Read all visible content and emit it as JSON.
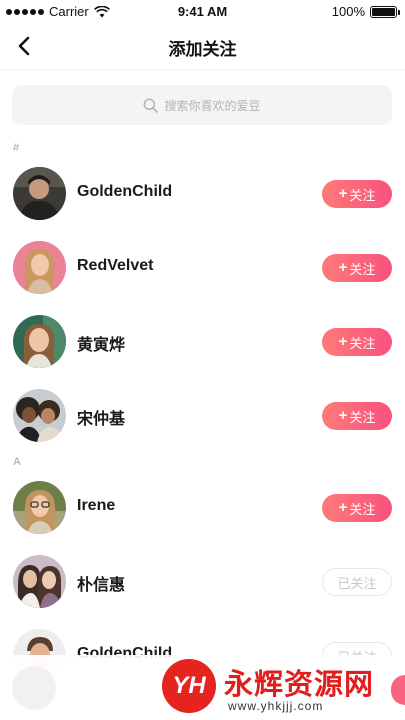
{
  "status_bar": {
    "carrier": "Carrier",
    "time": "9:41 AM",
    "battery": "100%",
    "battery_level": 1.0
  },
  "nav": {
    "title": "添加关注",
    "back_icon": "chevron-left-icon"
  },
  "search": {
    "placeholder": "搜索你喜欢的爱豆",
    "icon": "search-icon"
  },
  "sections": [
    {
      "label": "#",
      "items": [
        {
          "name": "GoldenChild",
          "action": "关注",
          "followed": false,
          "action_prefix": "+"
        },
        {
          "name": "RedVelvet",
          "action": "关注",
          "followed": false,
          "action_prefix": "+"
        },
        {
          "name": "黄寅烨",
          "action": "关注",
          "followed": false,
          "action_prefix": "+"
        },
        {
          "name": "宋仲基",
          "action": "关注",
          "followed": false,
          "action_prefix": "+"
        }
      ]
    },
    {
      "label": "A",
      "items": [
        {
          "name": "Irene",
          "action": "关注",
          "followed": false,
          "action_prefix": "+"
        },
        {
          "name": "朴信惠",
          "action": "已关注",
          "followed": true,
          "action_prefix": ""
        },
        {
          "name": "GoldenChild",
          "action": "已关注",
          "followed": true,
          "action_prefix": ""
        }
      ]
    }
  ],
  "watermark": {
    "logo": "YH",
    "title": "永辉资源网",
    "url": "www.yhkjjj.com"
  },
  "colors": {
    "accent_start": "#ff7a78",
    "accent_end": "#f8527e",
    "watermark_red": "#e01e1e"
  }
}
